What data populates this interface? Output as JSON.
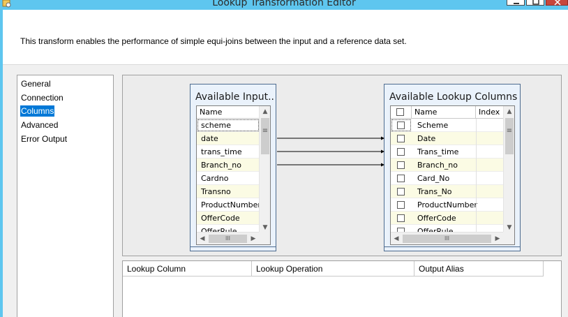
{
  "window": {
    "title": "Lookup Transformation Editor",
    "icon": "ssis-transform-icon"
  },
  "header": {
    "description": "This transform enables the performance of simple equi-joins between the input and a reference data set."
  },
  "nav": {
    "items": [
      {
        "label": "General",
        "selected": false
      },
      {
        "label": "Connection",
        "selected": false
      },
      {
        "label": "Columns",
        "selected": true
      },
      {
        "label": "Advanced",
        "selected": false
      },
      {
        "label": "Error Output",
        "selected": false
      }
    ]
  },
  "input_panel": {
    "title": "Available Input...",
    "header_name": "Name",
    "rows": [
      "scheme",
      "date",
      "trans_time",
      "Branch_no",
      "Cardno",
      "Transno",
      "ProductNumber",
      "OfferCode",
      "OfferRule"
    ]
  },
  "lookup_panel": {
    "title": "Available Lookup Columns",
    "header_name": "Name",
    "header_index": "Index",
    "rows": [
      "Scheme",
      "Date",
      "Trans_time",
      "Branch_no",
      "Card_No",
      "Trans_No",
      "ProductNumber",
      "OfferCode",
      "OfferRule"
    ]
  },
  "mappings": [
    {
      "from": "date",
      "to": "Date"
    },
    {
      "from": "trans_time",
      "to": "Trans_time"
    },
    {
      "from": "Branch_no",
      "to": "Branch_no"
    }
  ],
  "lookup_grid": {
    "columns": [
      "Lookup Column",
      "Lookup Operation",
      "Output Alias"
    ]
  },
  "colors": {
    "titlebar": "#5ec6ef",
    "selection": "#0078d7",
    "row_alt": "#fbfbe4",
    "panel_bg": "#eaf2fb",
    "close_button": "#c7463c"
  }
}
